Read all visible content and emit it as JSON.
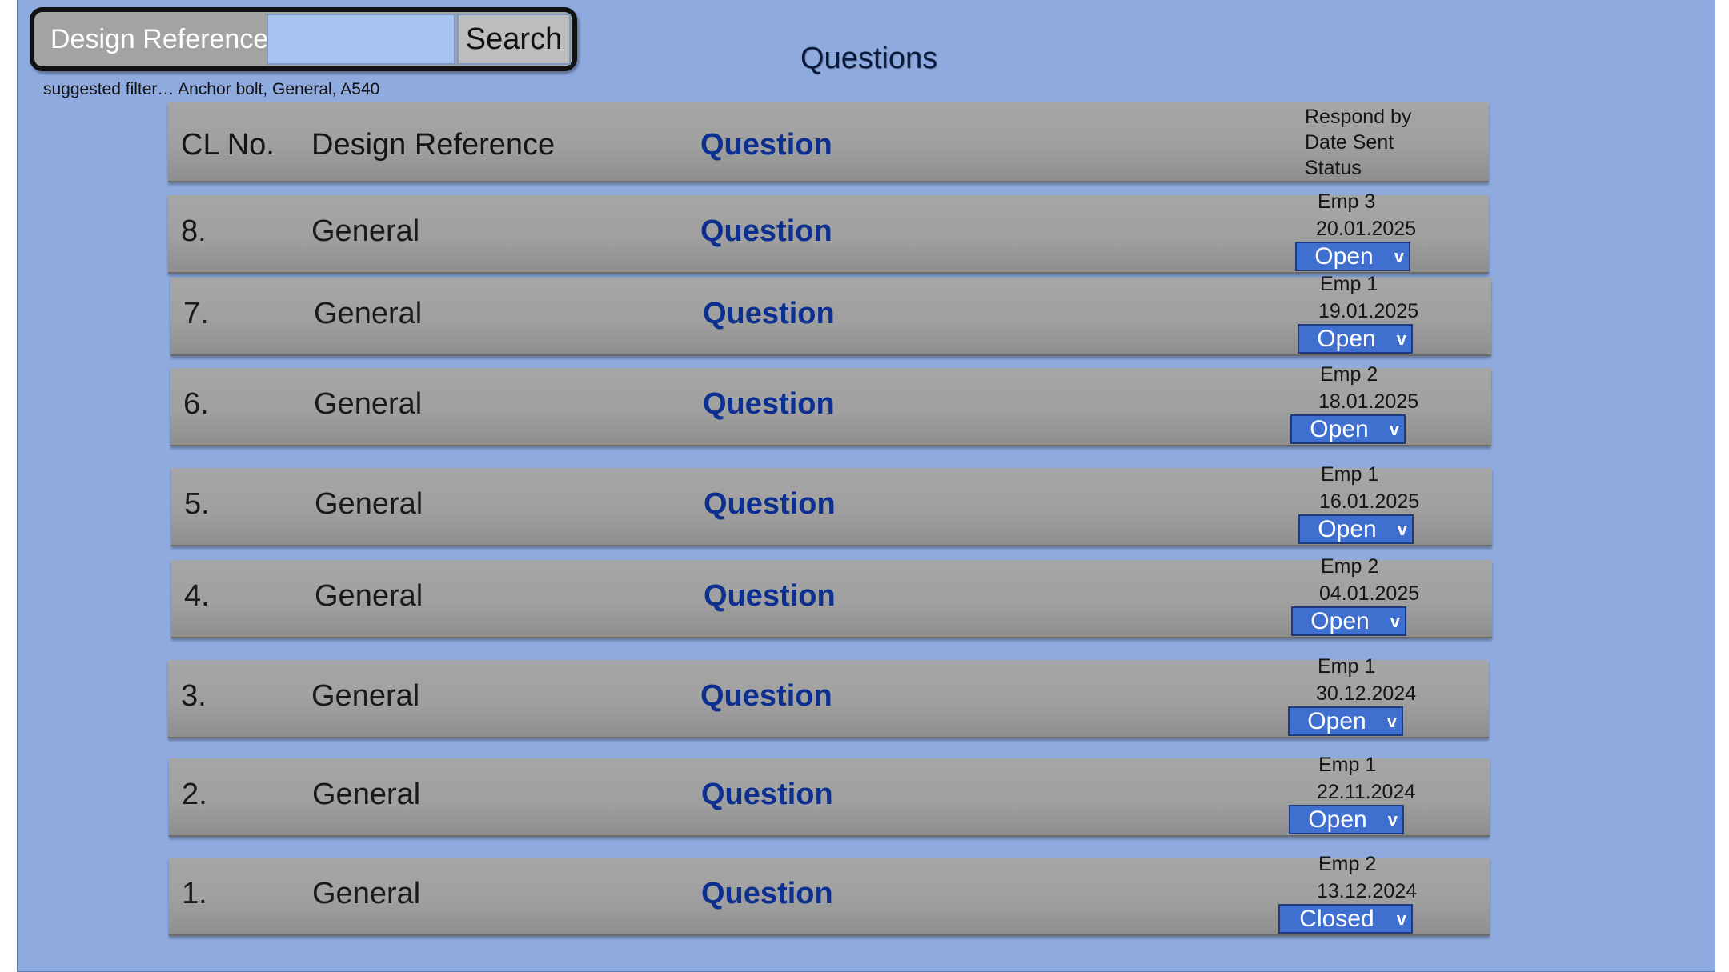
{
  "search": {
    "label": "Design Reference:",
    "value": "",
    "placeholder": "",
    "button_label": "Search",
    "hint": "suggested filter… Anchor bolt, General, A540"
  },
  "title": "Questions",
  "table": {
    "headers": {
      "cl_no": "CL No.",
      "design_reference": "Design Reference",
      "question": "Question",
      "respond_by": "Respond by",
      "date_sent": "Date Sent",
      "status": "Status"
    },
    "rows": [
      {
        "cl_no": "8.",
        "design_reference": "General",
        "question": "Question",
        "respond_by": "Emp  3",
        "date_sent": "20.01.2025",
        "status": "Open"
      },
      {
        "cl_no": "7.",
        "design_reference": "General",
        "question": "Question",
        "respond_by": "Emp  1",
        "date_sent": "19.01.2025",
        "status": "Open"
      },
      {
        "cl_no": "6.",
        "design_reference": "General",
        "question": "Question",
        "respond_by": "Emp  2",
        "date_sent": "18.01.2025",
        "status": "Open"
      },
      {
        "cl_no": "5.",
        "design_reference": "General",
        "question": "Question",
        "respond_by": "Emp  1",
        "date_sent": "16.01.2025",
        "status": "Open"
      },
      {
        "cl_no": "4.",
        "design_reference": "General",
        "question": "Question",
        "respond_by": "Emp  2",
        "date_sent": "04.01.2025",
        "status": "Open"
      },
      {
        "cl_no": "3.",
        "design_reference": "General",
        "question": "Question",
        "respond_by": "Emp  1",
        "date_sent": "30.12.2024",
        "status": "Open"
      },
      {
        "cl_no": "2.",
        "design_reference": "General",
        "question": "Question",
        "respond_by": "Emp  1",
        "date_sent": "22.11.2024",
        "status": "Open"
      },
      {
        "cl_no": "1.",
        "design_reference": "General",
        "question": "Question",
        "respond_by": "Emp  2",
        "date_sent": "13.12.2024",
        "status": "Closed"
      }
    ]
  },
  "icons": {
    "status_dropdown": "chevron-down-icon"
  },
  "colors": {
    "background": "#8eaadf",
    "status_button": "#3f6fcf",
    "question_text": "#0d2f8f",
    "row_band": "#a3a3a3"
  }
}
